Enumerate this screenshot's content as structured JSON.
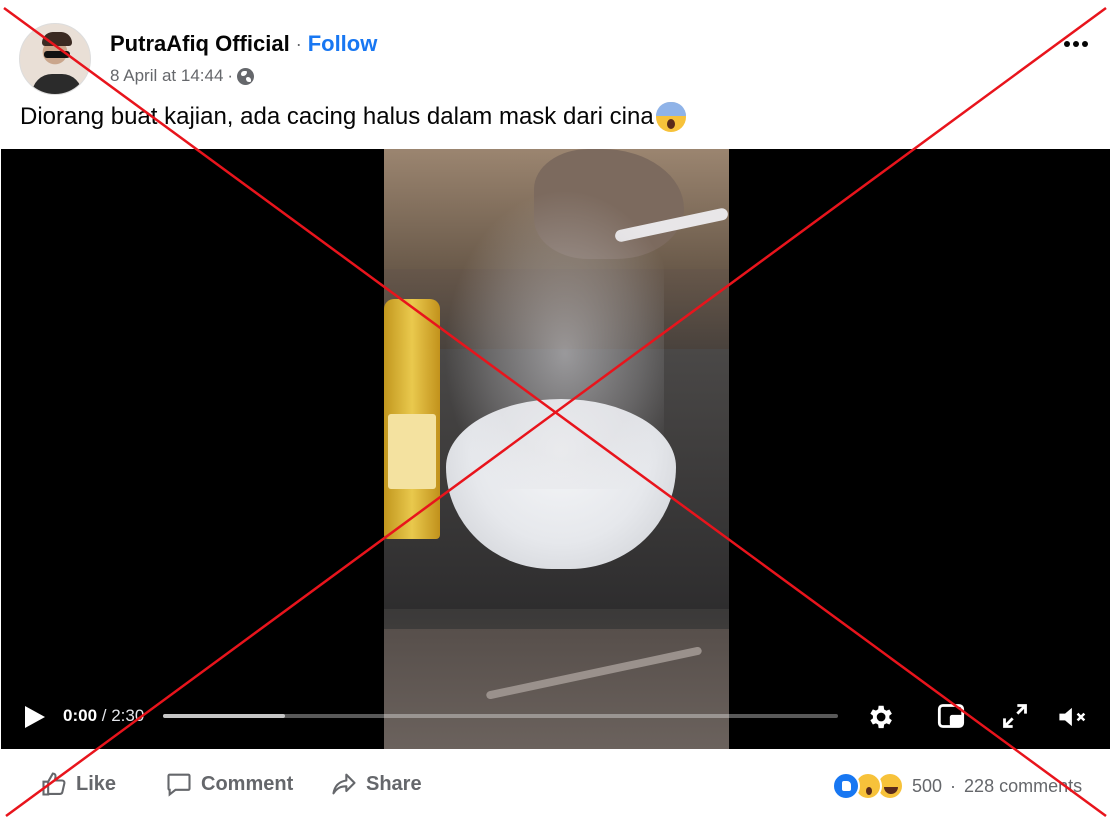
{
  "post": {
    "author": "PutraAfiq Official",
    "separator": "·",
    "follow_label": "Follow",
    "timestamp": "8 April at 14:44",
    "meta_separator": "·",
    "privacy_icon": "globe-icon",
    "more_icon": "more-options-icon",
    "text": "Diorang buat kajian, ada cacing halus dalam mask dari cina",
    "text_emoji": "face-screaming-in-fear-emoji"
  },
  "video": {
    "current_time": "0:00",
    "time_separator": " / ",
    "duration": "2:30",
    "progress": 0.0,
    "buffered": 0.18,
    "muted": true,
    "controls": [
      "play-icon",
      "settings-gear-icon",
      "picture-in-picture-icon",
      "fullscreen-icon",
      "muted-speaker-icon"
    ]
  },
  "actions": {
    "like_label": "Like",
    "comment_label": "Comment",
    "share_label": "Share"
  },
  "engagement": {
    "reactions": [
      "like",
      "wow",
      "haha"
    ],
    "reaction_count": "500",
    "separator": "·",
    "comments_label": "228 comments"
  },
  "overlay": {
    "type": "red-cross",
    "color": "#e8141c"
  },
  "colors": {
    "accent": "#1877f2",
    "secondary_text": "#65676b",
    "video_bg": "#000000"
  }
}
